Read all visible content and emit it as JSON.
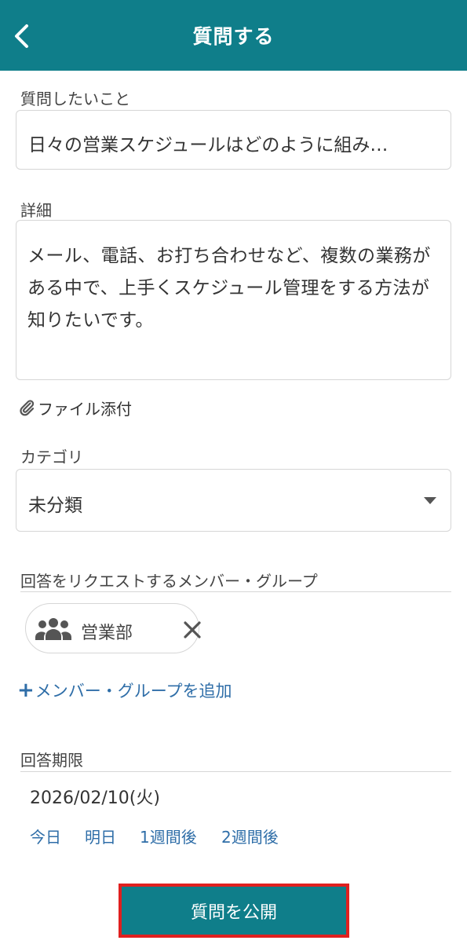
{
  "header": {
    "title": "質問する"
  },
  "question": {
    "label": "質問したいこと",
    "value": "日々の営業スケジュールはどのように組み…"
  },
  "detail": {
    "label": "詳細",
    "value": "メール、電話、お打ち合わせなど、複数の業務がある中で、上手くスケジュール管理をする方法が知りたいです。"
  },
  "attachment": {
    "label": "ファイル添付"
  },
  "category": {
    "label": "カテゴリ",
    "selected": "未分類"
  },
  "request": {
    "label": "回答をリクエストするメンバー・グループ",
    "chips": [
      {
        "label": "営業部"
      }
    ],
    "add_label": "メンバー・グループを追加",
    "add_symbol": "+"
  },
  "deadline": {
    "label": "回答期限",
    "value": "2026/02/10(火)",
    "quick_options": [
      "今日",
      "明日",
      "1週間後",
      "2週間後"
    ]
  },
  "publish_label": "質問を公開",
  "colors": {
    "header_bg": "#0f7e8a",
    "link": "#2f6ea8",
    "highlight": "#e0201f"
  }
}
